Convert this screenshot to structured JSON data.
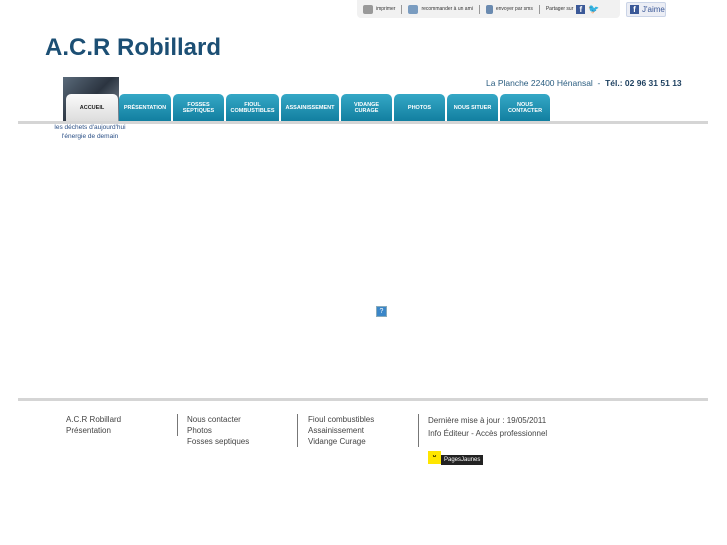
{
  "toolbar": {
    "print": "imprimer",
    "recommend": "recommander à un ami",
    "sms": "envoyer par sms",
    "share": "Partager sur",
    "like": "J'aime"
  },
  "header": {
    "title": "A.C.R Robillard",
    "address": "La Planche 22400 Hénansal",
    "phone": "Tél.: 02 96 31 51 13",
    "slogan_1": "les déchets d'aujourd'hui",
    "slogan_2": "l'énergie de demain"
  },
  "nav": [
    "ACCUEIL",
    "PRÉSENTATION",
    "FOSSES\nSEPTIQUES",
    "FIOUL\nCOMBUSTIBLES",
    "ASSAINISSEMENT",
    "VIDANGE\nCURAGE",
    "PHOTOS",
    "NOUS SITUER",
    "NOUS\nCONTACTER"
  ],
  "main": {
    "placeholder_icon": "?"
  },
  "footer": {
    "col1": [
      "A.C.R Robillard",
      "Présentation"
    ],
    "col2": [
      "Nous contacter",
      "Photos",
      "Fosses septiques"
    ],
    "col3": [
      "Fioul combustibles",
      "Assainissement",
      "Vidange Curage"
    ],
    "updated": "Dernière mise à jour : 19/05/2011",
    "info": "Info Éditeur",
    "dash": "-",
    "pro": "Accès professionnel",
    "pj": "PagesJaunes"
  }
}
